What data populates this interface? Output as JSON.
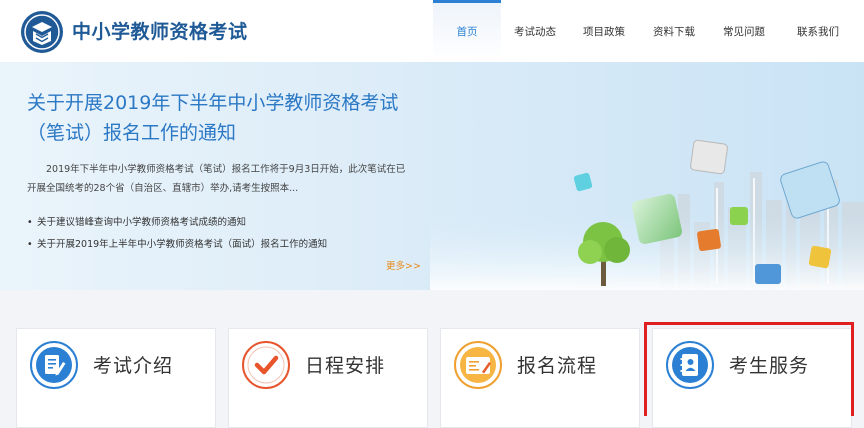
{
  "header": {
    "site_title": "中小学教师资格考试",
    "nav": [
      {
        "label": "首页",
        "active": true
      },
      {
        "label": "考试动态",
        "active": false
      },
      {
        "label": "项目政策",
        "active": false
      },
      {
        "label": "资料下载",
        "active": false
      },
      {
        "label": "常见问题",
        "active": false
      },
      {
        "label": "联系我们",
        "active": false
      }
    ]
  },
  "banner": {
    "title": "关于开展2019年下半年中小学教师资格考试（笔试）报名工作的通知",
    "description": "2019年下半年中小学教师资格考试（笔试）报名工作将于9月3日开始，此次笔试在已开展全国统考的28个省（自治区、直辖市）举办,请考生按照本...",
    "news": [
      "关于建议错峰查询中小学教师资格考试成绩的通知",
      "关于开展2019年上半年中小学教师资格考试（面试）报名工作的通知"
    ],
    "more_label": "更多>>"
  },
  "cards": [
    {
      "label": "考试介绍",
      "icon": "document-edit-icon"
    },
    {
      "label": "日程安排",
      "icon": "checkmark-icon"
    },
    {
      "label": "报名流程",
      "icon": "registration-form-icon"
    },
    {
      "label": "考生服务",
      "icon": "contact-book-icon"
    }
  ],
  "colors": {
    "brand_blue": "#1f5a97",
    "accent_blue": "#2b80d4",
    "more_orange": "#e98a1a",
    "highlight_red": "#e02020"
  }
}
